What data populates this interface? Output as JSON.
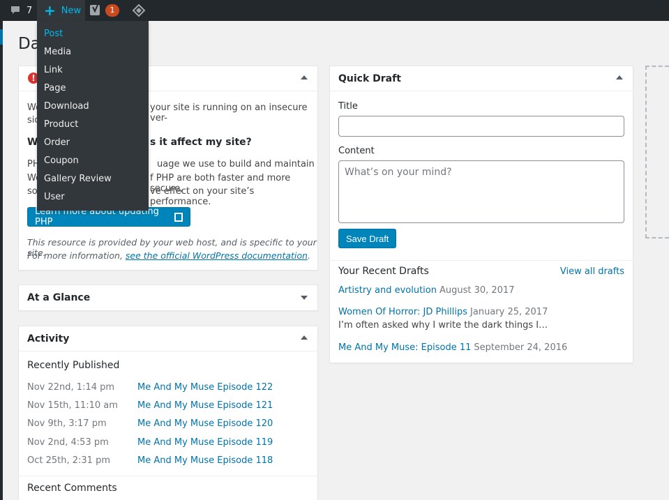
{
  "adminbar": {
    "comments_count": "7",
    "new_label": "New",
    "notification_count": "1"
  },
  "page": {
    "title_visible": "Da"
  },
  "new_menu": {
    "items": [
      "Post",
      "Media",
      "Link",
      "Page",
      "Download",
      "Product",
      "Order",
      "Coupon",
      "Gallery Review",
      "User"
    ]
  },
  "php_notice": {
    "line1_left": "We",
    "line1_right": "your site is running on an insecure ver-",
    "line2_left": "sio",
    "heading_left": "Wh",
    "heading_right": "s it affect my site?",
    "para_line1_left": "PH",
    "para_line1_right": "uage we use to build and maintain",
    "para_line2_left": "Wo",
    "para_line2_right": "f PHP are both faster and more secure,",
    "para_line3_left": "so",
    "para_line3_right": "ve effect on your site’s performance.",
    "button_label": "Learn more about updating PHP",
    "note_line1": "This resource is provided by your web host, and is specific to your site.",
    "note_line2_prefix": "For more information,",
    "note_link": "see the official WordPress documentation",
    "note_suffix": "."
  },
  "glance": {
    "title": "At a Glance"
  },
  "activity": {
    "title": "Activity",
    "recently_published_label": "Recently Published",
    "rows": [
      {
        "date": "Nov 22nd, 1:14 pm",
        "title": "Me And My Muse Episode 122"
      },
      {
        "date": "Nov 15th, 11:10 am",
        "title": "Me And My Muse Episode 121"
      },
      {
        "date": "Nov 9th, 3:17 pm",
        "title": "Me And My Muse Episode 120"
      },
      {
        "date": "Nov 2nd, 4:53 pm",
        "title": "Me And My Muse Episode 119"
      },
      {
        "date": "Oct 25th, 2:31 pm",
        "title": "Me And My Muse Episode 118"
      }
    ],
    "recent_comments_label": "Recent Comments"
  },
  "quick_draft": {
    "title": "Quick Draft",
    "title_label": "Title",
    "title_value": "",
    "content_label": "Content",
    "content_placeholder": "What’s on your mind?",
    "save_label": "Save Draft",
    "recent_drafts_label": "Your Recent Drafts",
    "view_all_label": "View all drafts",
    "drafts": [
      {
        "title": "Artistry and evolution",
        "date": "August 30, 2017",
        "excerpt": ""
      },
      {
        "title": "Women Of Horror: JD Phillips",
        "date": "January 25, 2017",
        "excerpt": "I’m often asked why I write the dark things I…"
      },
      {
        "title": "Me And My Muse: Episode 11",
        "date": "September 24, 2016",
        "excerpt": ""
      }
    ]
  }
}
